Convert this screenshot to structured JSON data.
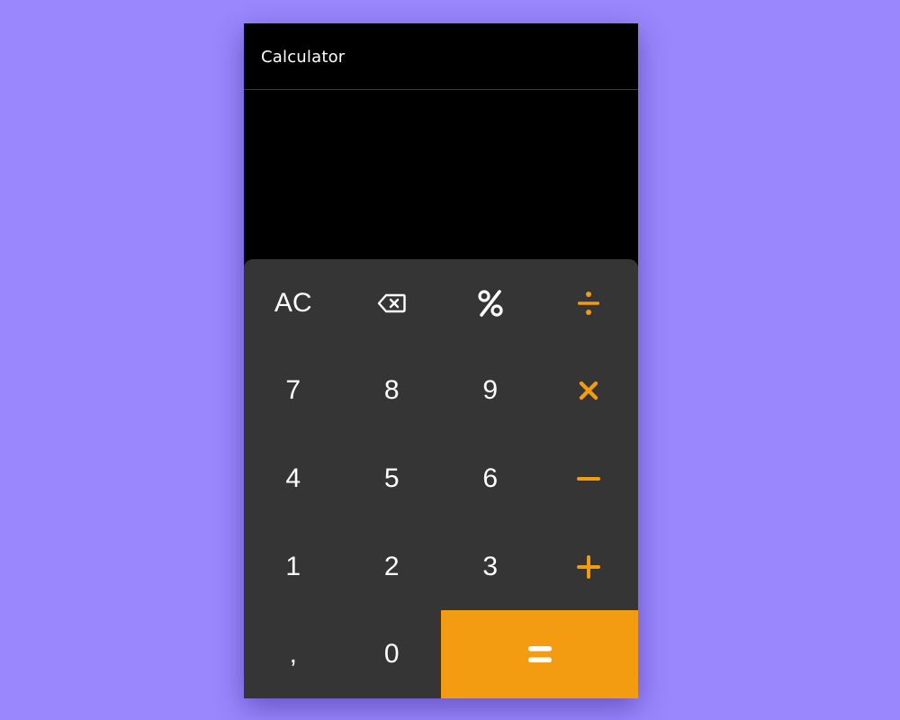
{
  "app": {
    "title": "Calculator"
  },
  "display": {
    "value": ""
  },
  "keys": {
    "clear": "AC",
    "seven": "7",
    "eight": "8",
    "nine": "9",
    "four": "4",
    "five": "5",
    "six": "6",
    "one": "1",
    "two": "2",
    "three": "3",
    "comma": ",",
    "zero": "0"
  },
  "icons": {
    "backspace": "backspace-icon",
    "percent": "percent-icon",
    "divide": "divide-icon",
    "multiply": "multiply-icon",
    "minus": "minus-icon",
    "plus": "plus-icon",
    "equals": "equals-icon"
  },
  "colors": {
    "background": "#9a87fe",
    "calculator": "#000000",
    "keypad": "#353535",
    "accent": "#f39c12",
    "text": "#ffffff"
  }
}
